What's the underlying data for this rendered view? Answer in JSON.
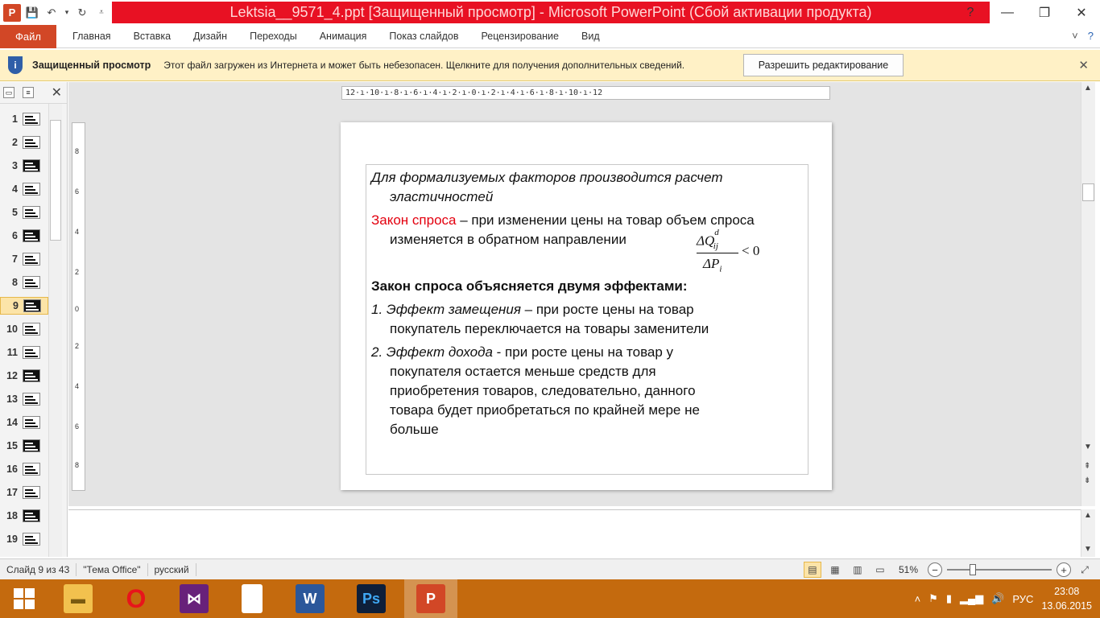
{
  "window": {
    "title": "Lektsia__9571_4.ppt [Защищенный просмотр] - Microsoft PowerPoint (Сбой активации продукта)"
  },
  "ribbon": {
    "file_tab": "Файл",
    "tabs": [
      "Главная",
      "Вставка",
      "Дизайн",
      "Переходы",
      "Анимация",
      "Показ слайдов",
      "Рецензирование",
      "Вид"
    ]
  },
  "protected_view": {
    "title": "Защищенный просмотр",
    "message": "Этот файл загружен из Интернета и может быть небезопасен. Щелкните для получения дополнительных сведений.",
    "enable_button": "Разрешить редактирование"
  },
  "thumbnails": {
    "items": [
      "1",
      "2",
      "3",
      "4",
      "5",
      "6",
      "7",
      "8",
      "9",
      "10",
      "11",
      "12",
      "13",
      "14",
      "15",
      "16",
      "17",
      "18",
      "19"
    ],
    "selected": "9"
  },
  "ruler": {
    "horizontal": "12·ı·10·ı·8·ı·6·ı·4·ı·2·ı·0·ı·2·ı·4·ı·6·ı·8·ı·10·ı·12"
  },
  "slide": {
    "p1": "Для формализуемых факторов производится расчет",
    "p1b": "эластичностей",
    "p2_red": "Закон спроса",
    "p2_rest": " – при изменении цены на товар объем спроса",
    "p2b": "изменяется в обратном направлении",
    "formula_num": "ΔQ",
    "formula_sup": "d",
    "formula_sub": "ij",
    "formula_den": "ΔP",
    "formula_den_sub": "i",
    "formula_rest": "<  0",
    "p3": "Закон спроса объясняется двумя эффектами:",
    "p4_num": "1. ",
    "p4_it": "Эффект замещения",
    "p4_rest": " – при росте цены на товар",
    "p4b": "покупатель переключается на товары заменители",
    "p5_num": "2. ",
    "p5_it": "Эффект дохода",
    "p5_rest": " - при росте цены на товар у",
    "p5b": "покупателя остается меньше средств для",
    "p5c": "приобретения товаров, следовательно, данного",
    "p5d": "товара будет приобретаться по крайней мере не",
    "p5e": "больше"
  },
  "statusbar": {
    "slide_info": "Слайд 9 из 43",
    "theme": "\"Тема Office\"",
    "language": "русский",
    "zoom": "51%",
    "zoom_level": 0.51
  },
  "taskbar": {
    "tray_lang": "РУС",
    "time": "23:08",
    "date": "13.06.2015"
  },
  "colors": {
    "title_bar": "#e81123",
    "file_tab": "#d24726",
    "protected_bar": "#fff1c6",
    "taskbar": "#c46a0e",
    "highlight": "#e3000f"
  }
}
